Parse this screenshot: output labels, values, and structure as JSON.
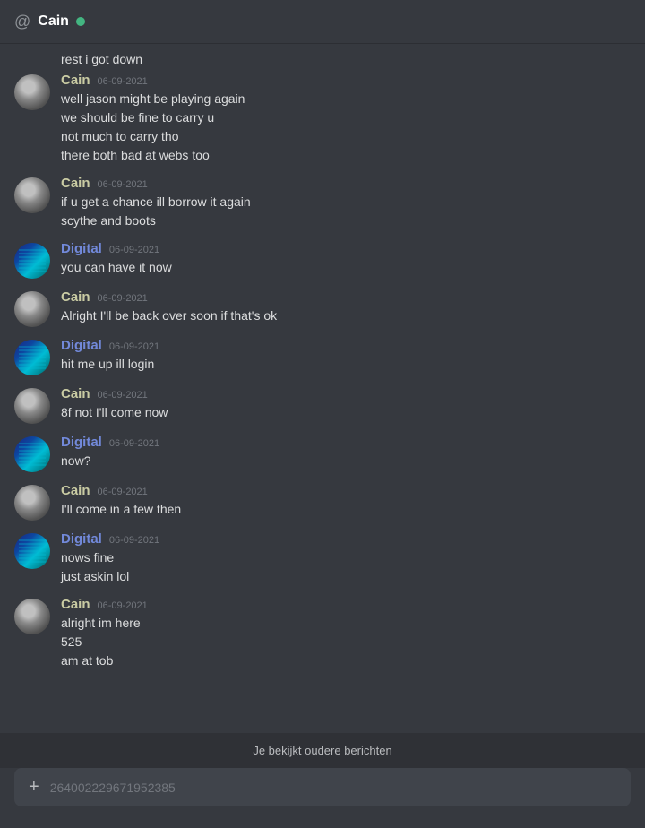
{
  "header": {
    "at_symbol": "@",
    "username": "Cain",
    "status": "online"
  },
  "messages": [
    {
      "id": "msg-partial",
      "type": "continuation",
      "text": "rest i got down"
    },
    {
      "id": "msg-1",
      "type": "group",
      "user": "Cain",
      "userType": "cain",
      "timestamp": "06-09-2021",
      "lines": [
        "well jason might be playing again",
        "we should be fine to carry u",
        "not much to carry tho",
        "there both bad at webs too"
      ]
    },
    {
      "id": "msg-2",
      "type": "group",
      "user": "Cain",
      "userType": "cain",
      "timestamp": "06-09-2021",
      "lines": [
        "if u get a chance ill borrow it again",
        "scythe and boots"
      ]
    },
    {
      "id": "msg-3",
      "type": "group",
      "user": "Digital",
      "userType": "digital",
      "timestamp": "06-09-2021",
      "lines": [
        "you can have it now"
      ]
    },
    {
      "id": "msg-4",
      "type": "group",
      "user": "Cain",
      "userType": "cain",
      "timestamp": "06-09-2021",
      "lines": [
        "Alright I'll be back over soon if that's ok"
      ]
    },
    {
      "id": "msg-5",
      "type": "group",
      "user": "Digital",
      "userType": "digital",
      "timestamp": "06-09-2021",
      "lines": [
        "hit me up ill login"
      ]
    },
    {
      "id": "msg-6",
      "type": "group",
      "user": "Cain",
      "userType": "cain",
      "timestamp": "06-09-2021",
      "lines": [
        "8f not I'll come now"
      ]
    },
    {
      "id": "msg-7",
      "type": "group",
      "user": "Digital",
      "userType": "digital",
      "timestamp": "06-09-2021",
      "lines": [
        "now?"
      ]
    },
    {
      "id": "msg-8",
      "type": "group",
      "user": "Cain",
      "userType": "cain",
      "timestamp": "06-09-2021",
      "lines": [
        "I'll come in a few then"
      ]
    },
    {
      "id": "msg-9",
      "type": "group",
      "user": "Digital",
      "userType": "digital",
      "timestamp": "06-09-2021",
      "lines": [
        "nows fine",
        "just askin lol"
      ]
    },
    {
      "id": "msg-10",
      "type": "group",
      "user": "Cain",
      "userType": "cain",
      "timestamp": "06-09-2021",
      "lines": [
        "alright im here",
        "525",
        "am at tob"
      ]
    }
  ],
  "banner": {
    "text": "Je bekijkt oudere berichten"
  },
  "input": {
    "placeholder": "264002229671952385",
    "plus_icon": "+"
  }
}
